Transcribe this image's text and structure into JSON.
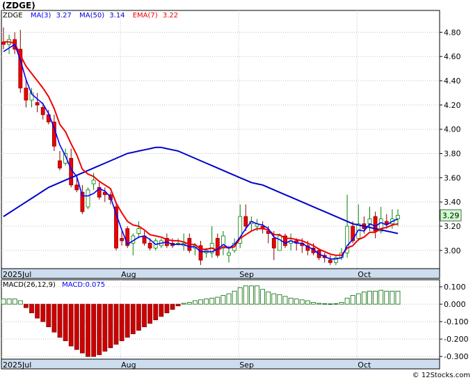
{
  "title": "(ZDGE)",
  "watermark": "© 12Stocks.com",
  "legend": {
    "ticker": "ZDGE",
    "ma3": "MA(3)",
    "ma3_val": "3.27",
    "ma50": "MA(50)",
    "ma50_val": "3.14",
    "ema7": "EMA(7)",
    "ema7_val": "3.22"
  },
  "last_price_label": "3.29",
  "macd_legend": {
    "name": "MACD(26,12,9)",
    "value": "MACD:0.075"
  },
  "colors": {
    "ma3": "#0000ff",
    "ma50": "#0000cc",
    "ema7": "#ee0000",
    "up_body": "#ffffff",
    "up_border": "#008000",
    "down_body": "#ee0000",
    "down_border": "#880000",
    "macd_pos": "#006600",
    "macd_neg": "#cc0000",
    "axis_band": "#ccddee",
    "price_badge": "#ccffcc"
  },
  "chart_data": [
    {
      "type": "candlestick",
      "x_months": [
        {
          "label": "2025Jul",
          "index": 0
        },
        {
          "label": "Aug",
          "index": 21
        },
        {
          "label": "Sep",
          "index": 42
        },
        {
          "label": "Oct",
          "index": 63
        }
      ],
      "y_ticks": [
        3.0,
        3.2,
        3.4,
        3.6,
        3.8,
        4.0,
        4.2,
        4.4,
        4.6,
        4.8
      ],
      "y_tick_labels": [
        "3.00",
        "3.20",
        "3.40",
        "3.60",
        "3.80",
        "4.00",
        "4.20",
        "4.40",
        "4.60",
        "4.80"
      ],
      "ylim": [
        2.85,
        4.98
      ],
      "ohlc": [
        [
          4.72,
          4.84,
          4.66,
          4.7
        ],
        [
          4.7,
          4.78,
          4.62,
          4.74
        ],
        [
          4.74,
          4.8,
          4.62,
          4.66
        ],
        [
          4.66,
          4.82,
          4.3,
          4.34
        ],
        [
          4.34,
          4.42,
          4.18,
          4.24
        ],
        [
          4.24,
          4.34,
          4.18,
          4.3
        ],
        [
          4.22,
          4.3,
          4.14,
          4.2
        ],
        [
          4.18,
          4.22,
          4.08,
          4.12
        ],
        [
          4.12,
          4.16,
          4.04,
          4.06
        ],
        [
          4.06,
          4.12,
          3.82,
          3.86
        ],
        [
          3.74,
          3.82,
          3.66,
          3.68
        ],
        [
          3.72,
          3.84,
          3.7,
          3.8
        ],
        [
          3.76,
          3.84,
          3.52,
          3.54
        ],
        [
          3.54,
          3.62,
          3.48,
          3.5
        ],
        [
          3.48,
          3.54,
          3.3,
          3.32
        ],
        [
          3.36,
          3.52,
          3.34,
          3.5
        ],
        [
          3.55,
          3.64,
          3.5,
          3.58
        ],
        [
          3.52,
          3.56,
          3.42,
          3.44
        ],
        [
          3.48,
          3.52,
          3.4,
          3.46
        ],
        [
          3.46,
          3.48,
          3.38,
          3.42
        ],
        [
          3.36,
          3.4,
          3.0,
          3.02
        ],
        [
          3.1,
          3.16,
          3.04,
          3.08
        ],
        [
          3.18,
          3.2,
          3.02,
          3.04
        ],
        [
          3.06,
          3.14,
          2.96,
          3.12
        ],
        [
          3.14,
          3.24,
          3.1,
          3.18
        ],
        [
          3.12,
          3.16,
          3.04,
          3.06
        ],
        [
          3.06,
          3.1,
          3.0,
          3.02
        ],
        [
          3.02,
          3.1,
          3.0,
          3.08
        ],
        [
          3.04,
          3.1,
          3.02,
          3.08
        ],
        [
          3.1,
          3.14,
          3.02,
          3.04
        ],
        [
          3.06,
          3.1,
          3.02,
          3.04
        ],
        [
          3.06,
          3.1,
          3.04,
          3.06
        ],
        [
          3.04,
          3.14,
          3.0,
          3.06
        ],
        [
          3.1,
          3.14,
          2.98,
          3.0
        ],
        [
          3.02,
          3.06,
          2.96,
          3.04
        ],
        [
          3.04,
          3.08,
          2.88,
          2.92
        ],
        [
          2.98,
          3.02,
          2.94,
          3.0
        ],
        [
          2.98,
          3.2,
          2.94,
          3.06
        ],
        [
          3.1,
          3.14,
          2.94,
          2.96
        ],
        [
          3.02,
          3.16,
          2.96,
          3.12
        ],
        [
          2.96,
          3.04,
          2.9,
          2.98
        ],
        [
          3.0,
          3.1,
          2.98,
          3.06
        ],
        [
          3.06,
          3.38,
          3.02,
          3.28
        ],
        [
          3.28,
          3.38,
          3.16,
          3.2
        ],
        [
          3.22,
          3.28,
          3.16,
          3.24
        ],
        [
          3.2,
          3.26,
          3.16,
          3.22
        ],
        [
          3.2,
          3.24,
          3.14,
          3.18
        ],
        [
          3.16,
          3.2,
          3.06,
          3.14
        ],
        [
          3.1,
          3.16,
          2.92,
          3.02
        ],
        [
          3.0,
          3.14,
          3.0,
          3.12
        ],
        [
          3.12,
          3.14,
          3.02,
          3.04
        ],
        [
          3.06,
          3.14,
          3.0,
          3.08
        ],
        [
          3.08,
          3.1,
          3.0,
          3.06
        ],
        [
          3.06,
          3.1,
          2.98,
          3.04
        ],
        [
          3.04,
          3.08,
          2.96,
          3.0
        ],
        [
          3.02,
          3.06,
          2.96,
          2.98
        ],
        [
          3.0,
          3.02,
          2.92,
          2.94
        ],
        [
          2.96,
          2.98,
          2.9,
          2.94
        ],
        [
          2.92,
          2.96,
          2.88,
          2.9
        ],
        [
          2.9,
          2.96,
          2.88,
          2.94
        ],
        [
          2.94,
          3.02,
          2.92,
          2.98
        ],
        [
          2.98,
          3.46,
          2.94,
          3.2
        ],
        [
          3.2,
          3.24,
          3.06,
          3.08
        ],
        [
          3.1,
          3.38,
          3.08,
          3.22
        ],
        [
          3.22,
          3.28,
          3.14,
          3.18
        ],
        [
          3.22,
          3.36,
          3.16,
          3.26
        ],
        [
          3.28,
          3.32,
          3.1,
          3.16
        ],
        [
          3.16,
          3.36,
          3.14,
          3.26
        ],
        [
          3.24,
          3.3,
          3.18,
          3.22
        ],
        [
          3.22,
          3.34,
          3.18,
          3.26
        ],
        [
          3.26,
          3.34,
          3.2,
          3.29
        ]
      ],
      "series": [
        {
          "name": "MA(3)",
          "values": [
            4.64,
            4.67,
            4.7,
            4.57,
            4.41,
            4.29,
            4.25,
            4.21,
            4.13,
            4.01,
            3.87,
            3.78,
            3.67,
            3.61,
            3.45,
            3.45,
            3.47,
            3.51,
            3.49,
            3.44,
            3.3,
            3.17,
            3.05,
            3.08,
            3.11,
            3.12,
            3.09,
            3.05,
            3.06,
            3.07,
            3.05,
            3.05,
            3.05,
            3.03,
            3.03,
            2.99,
            2.99,
            2.99,
            3.01,
            3.05,
            3.02,
            3.05,
            3.11,
            3.18,
            3.24,
            3.22,
            3.21,
            3.18,
            3.11,
            3.09,
            3.06,
            3.08,
            3.06,
            3.06,
            3.03,
            3.01,
            2.97,
            2.95,
            2.93,
            2.93,
            2.94,
            3.04,
            3.09,
            3.17,
            3.16,
            3.22,
            3.2,
            3.23,
            3.21,
            3.24,
            3.26
          ]
        },
        {
          "name": "MA(50)",
          "values": [
            3.28,
            3.31,
            3.34,
            3.37,
            3.4,
            3.43,
            3.46,
            3.49,
            3.52,
            3.54,
            3.56,
            3.58,
            3.6,
            3.62,
            3.64,
            3.66,
            3.68,
            3.7,
            3.72,
            3.74,
            3.76,
            3.78,
            3.8,
            3.81,
            3.82,
            3.83,
            3.84,
            3.85,
            3.85,
            3.84,
            3.83,
            3.82,
            3.8,
            3.78,
            3.76,
            3.74,
            3.72,
            3.7,
            3.68,
            3.66,
            3.64,
            3.62,
            3.6,
            3.58,
            3.56,
            3.55,
            3.54,
            3.52,
            3.5,
            3.48,
            3.46,
            3.44,
            3.42,
            3.4,
            3.38,
            3.36,
            3.34,
            3.32,
            3.3,
            3.28,
            3.26,
            3.24,
            3.22,
            3.21,
            3.2,
            3.19,
            3.18,
            3.17,
            3.16,
            3.15,
            3.14
          ]
        },
        {
          "name": "EMA(7)",
          "values": [
            4.72,
            4.72,
            4.71,
            4.61,
            4.52,
            4.46,
            4.4,
            4.34,
            4.27,
            4.17,
            4.04,
            3.98,
            3.88,
            3.79,
            3.67,
            3.63,
            3.61,
            3.57,
            3.54,
            3.51,
            3.39,
            3.31,
            3.24,
            3.21,
            3.2,
            3.17,
            3.13,
            3.12,
            3.11,
            3.09,
            3.08,
            3.08,
            3.07,
            3.05,
            3.05,
            3.01,
            3.01,
            3.02,
            3.0,
            3.03,
            3.02,
            3.03,
            3.1,
            3.13,
            3.16,
            3.18,
            3.18,
            3.17,
            3.13,
            3.13,
            3.1,
            3.1,
            3.09,
            3.08,
            3.06,
            3.04,
            3.01,
            2.99,
            2.97,
            2.96,
            2.96,
            3.02,
            3.04,
            3.09,
            3.11,
            3.15,
            3.15,
            3.18,
            3.19,
            3.21,
            3.22
          ]
        }
      ]
    },
    {
      "type": "bar",
      "name": "MACD(26,12,9)",
      "y_ticks": [
        0.1,
        0.0,
        -0.1,
        -0.2,
        -0.3
      ],
      "y_tick_labels": [
        "0.100",
        "0.000",
        "-0.100",
        "-0.200",
        "-0.300"
      ],
      "ylim": [
        -0.315,
        0.14
      ],
      "values": [
        0.03,
        0.03,
        0.03,
        0.02,
        -0.02,
        -0.05,
        -0.08,
        -0.1,
        -0.13,
        -0.16,
        -0.19,
        -0.21,
        -0.24,
        -0.26,
        -0.28,
        -0.3,
        -0.3,
        -0.29,
        -0.27,
        -0.25,
        -0.23,
        -0.21,
        -0.19,
        -0.17,
        -0.15,
        -0.13,
        -0.11,
        -0.09,
        -0.07,
        -0.05,
        -0.03,
        -0.01,
        0.005,
        0.01,
        0.02,
        0.025,
        0.03,
        0.035,
        0.04,
        0.05,
        0.06,
        0.075,
        0.095,
        0.105,
        0.105,
        0.105,
        0.085,
        0.07,
        0.06,
        0.055,
        0.045,
        0.035,
        0.03,
        0.025,
        0.02,
        0.01,
        0.005,
        0.003,
        0.002,
        0.003,
        0.01,
        0.035,
        0.05,
        0.06,
        0.07,
        0.075,
        0.075,
        0.08,
        0.075,
        0.075,
        0.075
      ]
    }
  ]
}
